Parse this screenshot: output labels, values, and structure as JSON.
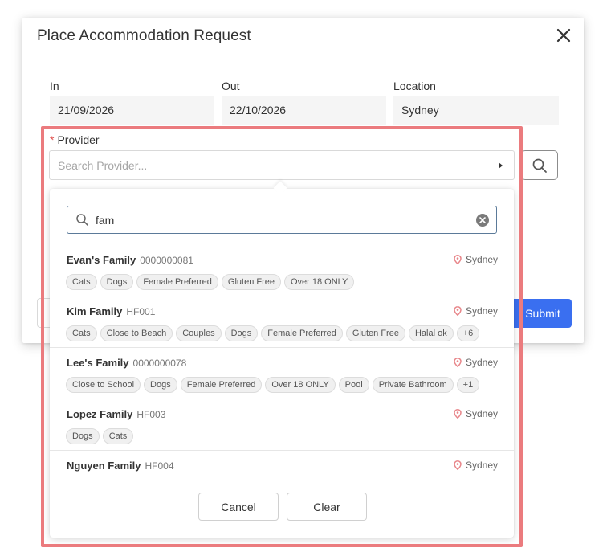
{
  "modal": {
    "title": "Place Accommodation Request",
    "fields": {
      "in_label": "In",
      "in_value": "21/09/2026",
      "out_label": "Out",
      "out_value": "22/10/2026",
      "location_label": "Location",
      "location_value": "Sydney"
    },
    "provider": {
      "required_mark": "*",
      "label": "Provider",
      "placeholder": "Search Provider..."
    },
    "submit_label": "Submit"
  },
  "dropdown": {
    "search_value": "fam",
    "results": [
      {
        "name": "Evan's Family",
        "id": "0000000081",
        "location": "Sydney",
        "tags": [
          "Cats",
          "Dogs",
          "Female Preferred",
          "Gluten Free",
          "Over 18 ONLY"
        ]
      },
      {
        "name": "Kim Family",
        "id": "HF001",
        "location": "Sydney",
        "tags": [
          "Cats",
          "Close to Beach",
          "Couples",
          "Dogs",
          "Female Preferred",
          "Gluten Free",
          "Halal ok",
          "+6"
        ]
      },
      {
        "name": "Lee's Family",
        "id": "0000000078",
        "location": "Sydney",
        "tags": [
          "Close to School",
          "Dogs",
          "Female Preferred",
          "Over 18 ONLY",
          "Pool",
          "Private Bathroom",
          "+1"
        ]
      },
      {
        "name": "Lopez Family",
        "id": "HF003",
        "location": "Sydney",
        "tags": [
          "Dogs",
          "Cats"
        ]
      },
      {
        "name": "Nguyen Family",
        "id": "HF004",
        "location": "Sydney",
        "tags": []
      }
    ],
    "cancel_label": "Cancel",
    "clear_label": "Clear"
  },
  "colors": {
    "primary": "#3a6ff0",
    "highlight": "#eb7b7e",
    "pin": "#e8868a"
  }
}
